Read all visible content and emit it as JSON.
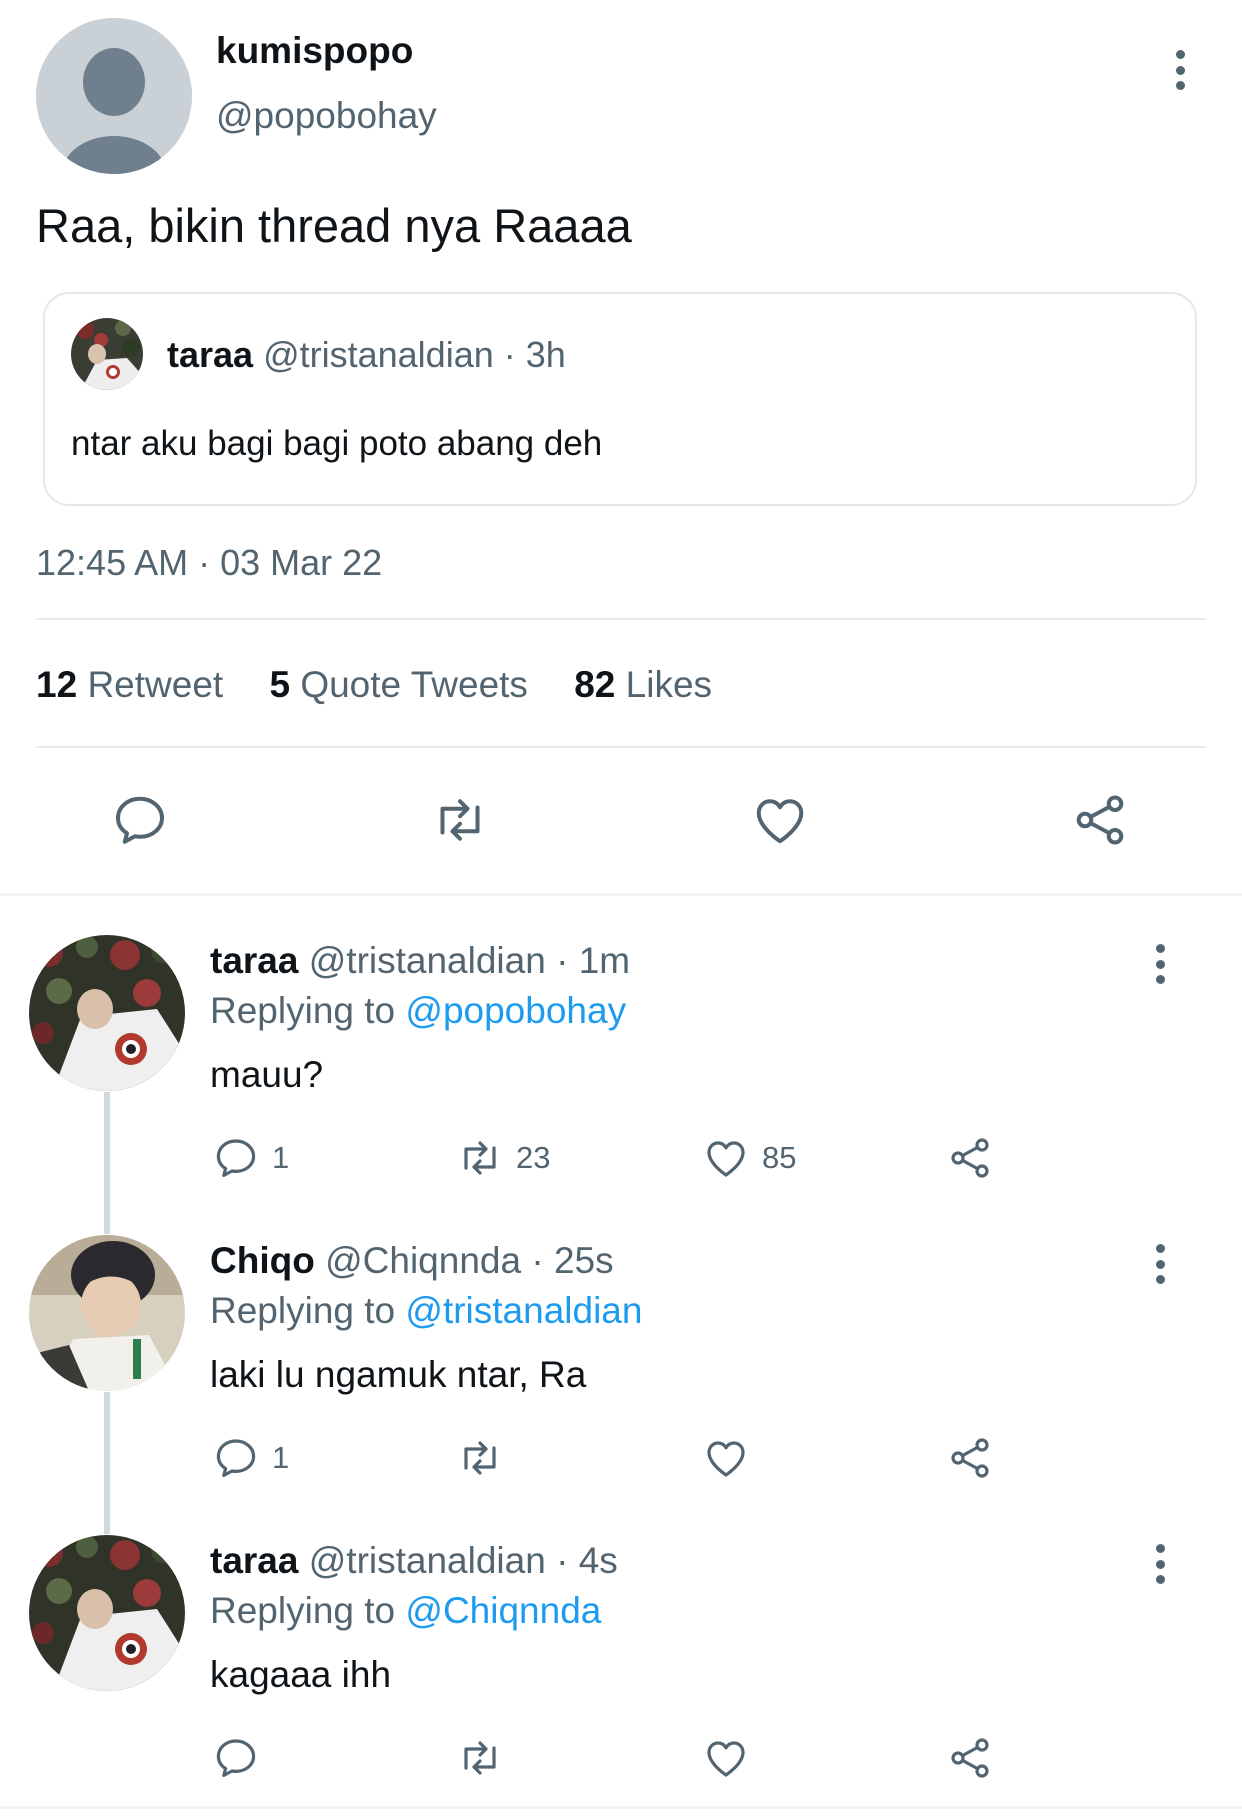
{
  "main_tweet": {
    "name": "kumispopo",
    "handle": "@popobohay",
    "text": "Raa, bikin thread nya Raaaa",
    "quote": {
      "name": "taraa",
      "handle": "@tristanaldian",
      "time": "· 3h",
      "text": "ntar aku bagi bagi poto abang deh"
    },
    "timestamp": "12:45 AM · 03 Mar 22",
    "stats": {
      "retweets_count": "12",
      "retweets_label": "Retweet",
      "quotes_count": "5",
      "quotes_label": "Quote Tweets",
      "likes_count": "82",
      "likes_label": "Likes"
    }
  },
  "replies": [
    {
      "name": "taraa",
      "handle": "@tristanaldian",
      "time": "· 1m",
      "replying_label": "Replying to",
      "replying_to": "@popobohay",
      "text": "mauu?",
      "reply_count": "1",
      "retweet_count": "23",
      "like_count": "85"
    },
    {
      "name": "Chiqo",
      "handle": "@Chiqnnda",
      "time": "· 25s",
      "replying_label": "Replying to",
      "replying_to": "@tristanaldian",
      "text": "laki lu ngamuk ntar, Ra",
      "reply_count": "1",
      "retweet_count": "",
      "like_count": ""
    },
    {
      "name": "taraa",
      "handle": "@tristanaldian",
      "time": "· 4s",
      "replying_label": "Replying to",
      "replying_to": "@Chiqnnda",
      "text": "kagaaa ihh",
      "reply_count": "",
      "retweet_count": "",
      "like_count": ""
    }
  ],
  "colors": {
    "link": "#1d9bf0",
    "muted": "#536471",
    "text": "#0f1419"
  }
}
